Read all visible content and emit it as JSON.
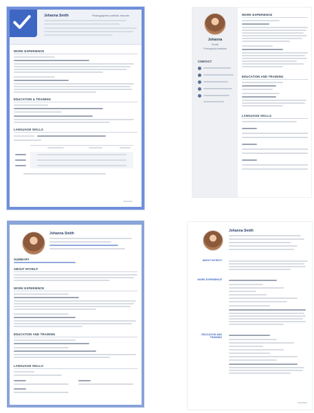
{
  "gallery": {
    "cards": [
      {
        "id": "resume-1",
        "selected": true,
        "name": "Johanna Smith",
        "role": "Photographer portfolio resume",
        "sections": [
          "WORK EXPERIENCE",
          "EDUCATION & TRAINING",
          "LANGUAGE SKILLS"
        ]
      },
      {
        "id": "resume-2",
        "name": "Johanna",
        "surname": "Smith",
        "subtitle": "Photography assistant",
        "sections": [
          "CONTACT",
          "WORK EXPERIENCE",
          "EDUCATION AND TRAINING",
          "LANGUAGE SKILLS"
        ]
      },
      {
        "id": "resume-3",
        "name": "Johanna Smith",
        "sections": [
          "SUMMARY",
          "ABOUT MYSELF",
          "WORK EXPERIENCE",
          "EDUCATION AND TRAINING",
          "LANGUAGE SKILLS"
        ]
      },
      {
        "id": "resume-4",
        "name": "Johanna Smith",
        "sections": [
          "ABOUT MYSELF",
          "WORK EXPERIENCE",
          "EDUCATION AND TRAINING"
        ]
      }
    ]
  },
  "colors": {
    "accent": "#3e67c4",
    "selection": "#6f8fd9"
  },
  "icons": {
    "selected": "checkmark-icon"
  }
}
